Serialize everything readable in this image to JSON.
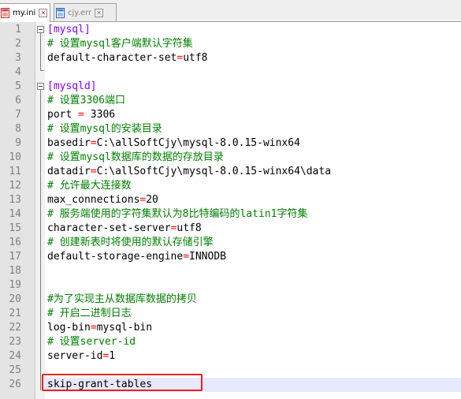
{
  "tabs": [
    {
      "label": "my.ini",
      "active": true,
      "icon": "file-red-icon"
    },
    {
      "label": "cjy.err",
      "active": false,
      "icon": "file-blue-icon"
    }
  ],
  "colors": {
    "section": "#8000ff",
    "comment": "#008000",
    "operator": "#ff0000",
    "highlight": "#e8231f"
  },
  "lines": [
    {
      "n": "1",
      "parts": [
        [
          "section",
          "[mysql]"
        ]
      ]
    },
    {
      "n": "2",
      "parts": [
        [
          "comment",
          "# 设置mysql客户端默认字符集"
        ]
      ]
    },
    {
      "n": "3",
      "parts": [
        [
          "key",
          "default-character-set"
        ],
        [
          "op",
          "="
        ],
        [
          "key",
          "utf8"
        ]
      ]
    },
    {
      "n": "4",
      "parts": []
    },
    {
      "n": "5",
      "parts": [
        [
          "section",
          "[mysqld]"
        ]
      ]
    },
    {
      "n": "6",
      "parts": [
        [
          "comment",
          "# 设置3306端口"
        ]
      ]
    },
    {
      "n": "7",
      "parts": [
        [
          "key",
          "port "
        ],
        [
          "op",
          "="
        ],
        [
          "key",
          " 3306"
        ]
      ]
    },
    {
      "n": "8",
      "parts": [
        [
          "comment",
          "# 设置mysql的安装目录"
        ]
      ]
    },
    {
      "n": "9",
      "parts": [
        [
          "key",
          "basedir"
        ],
        [
          "op",
          "="
        ],
        [
          "key",
          "C:\\allSoftCjy\\mysql-8.0.15-winx64"
        ]
      ]
    },
    {
      "n": "10",
      "parts": [
        [
          "comment",
          "# 设置mysql数据库的数据的存放目录"
        ]
      ]
    },
    {
      "n": "11",
      "parts": [
        [
          "key",
          "datadir"
        ],
        [
          "op",
          "="
        ],
        [
          "key",
          "C:\\allSoftCjy\\mysql-8.0.15-winx64\\data"
        ]
      ]
    },
    {
      "n": "12",
      "parts": [
        [
          "comment",
          "# 允许最大连接数"
        ]
      ]
    },
    {
      "n": "13",
      "parts": [
        [
          "key",
          "max_connections"
        ],
        [
          "op",
          "="
        ],
        [
          "key",
          "20"
        ]
      ]
    },
    {
      "n": "14",
      "parts": [
        [
          "comment",
          "# 服务端使用的字符集默认为8比特编码的latin1字符集"
        ]
      ]
    },
    {
      "n": "15",
      "parts": [
        [
          "key",
          "character-set-server"
        ],
        [
          "op",
          "="
        ],
        [
          "key",
          "utf8"
        ]
      ]
    },
    {
      "n": "16",
      "parts": [
        [
          "comment",
          "# 创建新表时将使用的默认存储引擎"
        ]
      ]
    },
    {
      "n": "17",
      "parts": [
        [
          "key",
          "default-storage-engine"
        ],
        [
          "op",
          "="
        ],
        [
          "key",
          "INNODB"
        ]
      ]
    },
    {
      "n": "18",
      "parts": []
    },
    {
      "n": "19",
      "parts": []
    },
    {
      "n": "20",
      "parts": [
        [
          "comment",
          "#为了实现主从数据库数据的拷贝"
        ]
      ]
    },
    {
      "n": "21",
      "parts": [
        [
          "comment",
          "# 开启二进制日志"
        ]
      ]
    },
    {
      "n": "22",
      "parts": [
        [
          "key",
          "log-bin"
        ],
        [
          "op",
          "="
        ],
        [
          "key",
          "mysql-bin"
        ]
      ]
    },
    {
      "n": "23",
      "parts": [
        [
          "comment",
          "# 设置server-id"
        ]
      ]
    },
    {
      "n": "24",
      "parts": [
        [
          "key",
          "server-id"
        ],
        [
          "op",
          "="
        ],
        [
          "key",
          "1"
        ]
      ]
    },
    {
      "n": "25",
      "parts": []
    },
    {
      "n": "26",
      "parts": [
        [
          "key",
          "skip-grant-tables"
        ]
      ]
    }
  ]
}
